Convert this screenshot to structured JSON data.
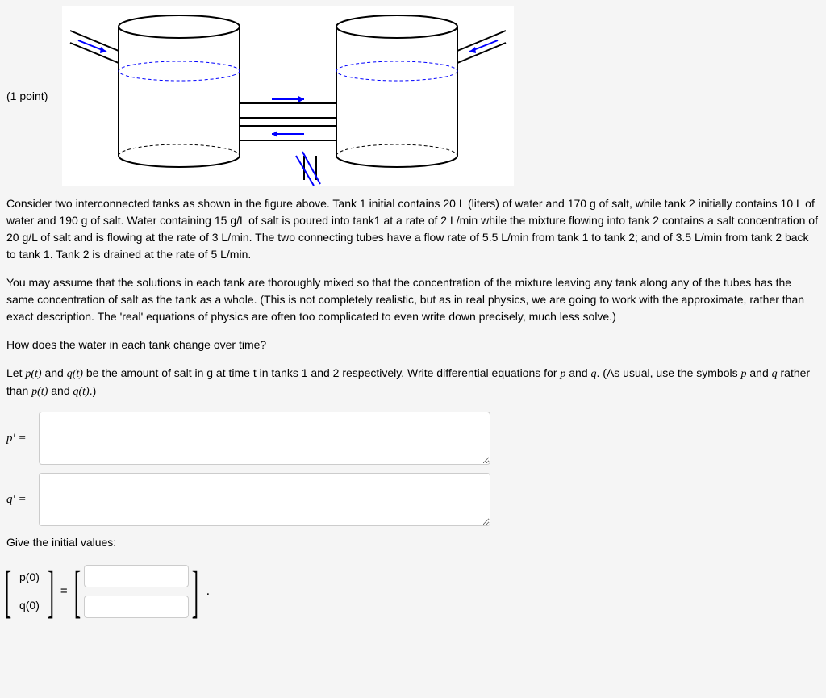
{
  "points": "(1 point)",
  "paragraph1": "Consider two interconnected tanks as shown in the figure above. Tank 1 initial contains 20 L (liters) of water and 170 g of salt, while tank 2 initially contains 10 L of water and 190 g of salt. Water containing 15 g/L of salt is poured into tank1 at a rate of 2 L/min while the mixture flowing into tank 2 contains a salt concentration of 20 g/L of salt and is flowing at the rate of 3 L/min. The two connecting tubes have a flow rate of 5.5 L/min from tank 1 to tank 2; and of 3.5 L/min from tank 2 back to tank 1. Tank 2 is drained at the rate of 5 L/min.",
  "paragraph2": "You may assume that the solutions in each tank are thoroughly mixed so that the concentration of the mixture leaving any tank along any of the tubes has the same concentration of salt as the tank as a whole. (This is not completely realistic, but as in real physics, we are going to work with the approximate, rather than exact description. The 'real' equations of physics are often too complicated to even write down precisely, much less solve.)",
  "question1": "How does the water in each tank change over time?",
  "paragraph3_pre": "Let ",
  "paragraph3_p": "p(t)",
  "paragraph3_mid1": " and ",
  "paragraph3_q": "q(t)",
  "paragraph3_mid2": " be the amount of salt in g at time t in tanks 1 and 2 respectively. Write differential equations for ",
  "paragraph3_pvar": "p",
  "paragraph3_mid3": " and ",
  "paragraph3_qvar": "q",
  "paragraph3_mid4": ". (As usual, use the symbols ",
  "paragraph3_p2": "p",
  "paragraph3_mid5": " and ",
  "paragraph3_q2": "q",
  "paragraph3_mid6": " rather than ",
  "paragraph3_pt": "p(t)",
  "paragraph3_mid7": " and ",
  "paragraph3_qt": "q(t)",
  "paragraph3_end": ".)",
  "label_pprime": "p′ =",
  "label_qprime": "q′ =",
  "initial_values_heading": "Give the initial values:",
  "vec_p0": "p(0)",
  "vec_q0": "q(0)",
  "eq_sign": "=",
  "period": "."
}
